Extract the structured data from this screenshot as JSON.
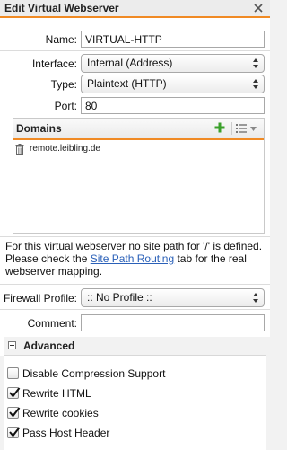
{
  "dialog": {
    "title": "Edit Virtual Webserver"
  },
  "form": {
    "name_label": "Name:",
    "name_value": "VIRTUAL-HTTP",
    "interface_label": "Interface:",
    "interface_value": "Internal (Address)",
    "type_label": "Type:",
    "type_value": "Plaintext (HTTP)",
    "port_label": "Port:",
    "port_value": "80"
  },
  "domains": {
    "title": "Domains",
    "items": [
      "remote.leibling.de"
    ]
  },
  "info": {
    "text_before": "For this virtual webserver no site path for '/' is defined. Please check the ",
    "link": "Site Path Routing",
    "text_after": " tab for the real webserver mapping."
  },
  "firewall": {
    "label": "Firewall Profile:",
    "value": ":: No Profile ::"
  },
  "comment": {
    "label": "Comment:",
    "value": ""
  },
  "advanced": {
    "title": "Advanced",
    "options": [
      {
        "label": "Disable Compression Support",
        "checked": false
      },
      {
        "label": "Rewrite HTML",
        "checked": true
      },
      {
        "label": "Rewrite cookies",
        "checked": true
      },
      {
        "label": "Pass Host Header",
        "checked": true
      }
    ]
  },
  "colors": {
    "accent": "#f08a24",
    "link": "#2a60b8",
    "add_icon": "#3aa02a"
  },
  "icons": [
    "close-icon",
    "add-icon",
    "list-view-icon",
    "chevron-down-icon",
    "trash-icon",
    "collapse-icon",
    "checkmark-icon",
    "select-arrows-icon"
  ]
}
